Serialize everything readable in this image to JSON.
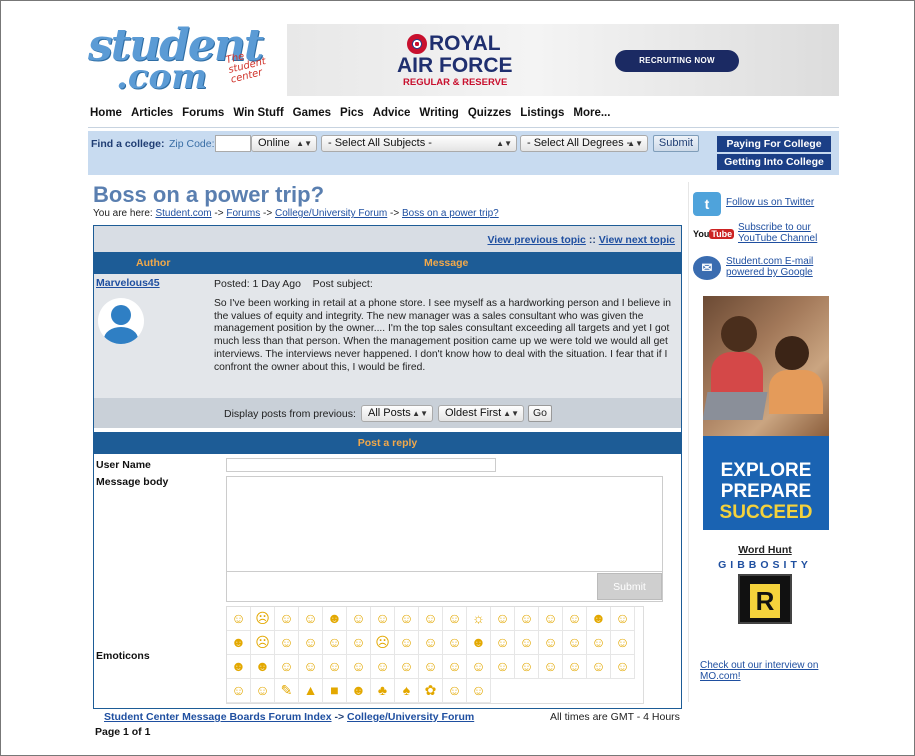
{
  "header": {
    "logo_main": "student",
    "logo_com": ".com",
    "logo_tag": "The student center",
    "ad": {
      "royal": "ROYAL",
      "air_force": "AIR FORCE",
      "regular_reserve": "REGULAR & RESERVE",
      "cta": "RECRUITING NOW"
    }
  },
  "nav": {
    "items": [
      "Home",
      "Articles",
      "Forums",
      "Win Stuff",
      "Games",
      "Pics",
      "Advice",
      "Writing",
      "Quizzes",
      "Listings",
      "More..."
    ]
  },
  "find": {
    "label": "Find a college:",
    "zip_label": "Zip Code:",
    "zip_value": "",
    "mode": "Online",
    "subject": "- Select All Subjects -",
    "degree": "- Select All Degrees -",
    "submit": "Submit",
    "paying": "Paying For College",
    "getting_into": "Getting Into College"
  },
  "page": {
    "title": "Boss on a power trip?",
    "breadcrumb_prefix": "You are here:",
    "breadcrumb": [
      "Student.com",
      "Forums",
      "College/University Forum",
      "Boss on a power trip?"
    ]
  },
  "topic": {
    "prev": "View previous topic",
    "sep": "::",
    "next": "View next topic",
    "col_author": "Author",
    "col_message": "Message",
    "author": "Marvelous45",
    "posted": "Posted: 1 Day Ago",
    "subject_label": "Post subject:",
    "body": "So I've been working in retail at a phone store. I see myself as a hardworking person and I believe in the values of equity and integrity. The new manager was a sales consultant who was given the management position by the owner.... I'm the top sales consultant exceeding all targets and yet I got much less than that person. When the management position came up we were told we would all get interviews. The interviews never happened. I don't know how to deal with the situation. I fear that if I confront the owner about this, I would be fired.",
    "display_label": "Display posts from previous:",
    "display_posts": "All Posts",
    "display_order": "Oldest First",
    "go": "Go"
  },
  "reply": {
    "title": "Post a reply",
    "username_label": "User Name",
    "message_label": "Message body",
    "submit": "Submit",
    "emoticons_label": "Emoticons",
    "emoticons": [
      "☺",
      "☹",
      "☺",
      "☺",
      "☻",
      "☺",
      "☺",
      "☺",
      "☺",
      "☺",
      "☼",
      "☺",
      "☺",
      "☺",
      "☺",
      "☻",
      "☺",
      "☻",
      "☹",
      "☺",
      "☺",
      "☺",
      "☺",
      "☹",
      "☺",
      "☺",
      "☺",
      "☻",
      "☺",
      "☺",
      "☺",
      "☺",
      "☺",
      "☺",
      "☻",
      "☻",
      "☺",
      "☺",
      "☺",
      "☺",
      "☺",
      "☺",
      "☺",
      "☺",
      "☺",
      "☺",
      "☺",
      "☺",
      "☺",
      "☺",
      "☺",
      "☺",
      "☺",
      "✎",
      "▲",
      "■",
      "☻",
      "♣",
      "♠",
      "✿",
      "☺",
      "☺"
    ]
  },
  "footer": {
    "index": "Student Center Message Boards Forum Index",
    "arrow": "->",
    "forum": "College/University Forum",
    "timezone": "All times are GMT - 4 Hours",
    "pages": "Page 1 of 1"
  },
  "sidebar": {
    "twitter": "Follow us on Twitter",
    "youtube": "Subscribe to our YouTube Channel",
    "youtube_icon": "YouTube",
    "email": "Student.com E-mail powered by Google",
    "ad_lines": [
      "EXPLORE",
      "PREPARE",
      "SUCCEED"
    ],
    "word_hunt_title": "Word Hunt",
    "word_hunt_word": "GIBBOSITY",
    "word_hunt_letter": "R",
    "interview": "Check out our interview on MO.com!"
  }
}
